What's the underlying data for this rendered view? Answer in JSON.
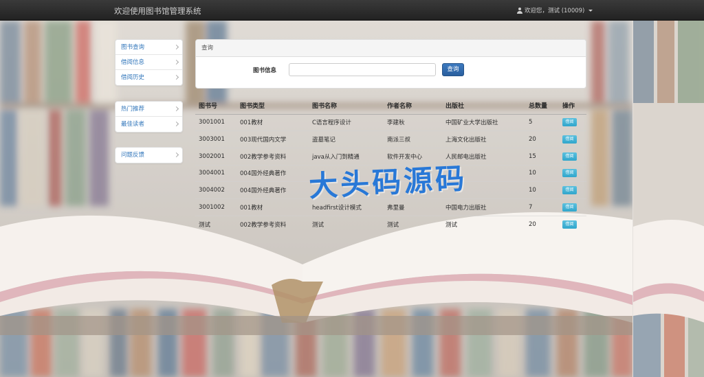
{
  "navbar": {
    "brand": "欢迎使用图书馆管理系统",
    "user_greeting": "欢迎您，测试 (10009)",
    "user_icon": "user-icon"
  },
  "sidebar": {
    "group1": [
      {
        "label": "图书查询"
      },
      {
        "label": "借阅信息"
      },
      {
        "label": "借阅历史"
      }
    ],
    "group2": [
      {
        "label": "热门推荐"
      },
      {
        "label": "最佳读者"
      }
    ],
    "group3": [
      {
        "label": "问题反馈"
      }
    ]
  },
  "query_panel": {
    "heading": "查询",
    "field_label": "图书信息",
    "input_value": "",
    "button_label": "查询"
  },
  "table": {
    "headers": [
      "图书号",
      "图书类型",
      "图书名称",
      "作者名称",
      "出版社",
      "总数量",
      "操作"
    ],
    "rows": [
      {
        "id": "3001001",
        "type": "001教材",
        "name": "C语言程序设计",
        "author": "李建秋",
        "publisher": "中国矿业大学出版社",
        "count": "5",
        "action": "借阅"
      },
      {
        "id": "3003001",
        "type": "003现代国内文学",
        "name": "盗墓笔记",
        "author": "南派三叔",
        "publisher": "上海文化出版社",
        "count": "20",
        "action": "借阅"
      },
      {
        "id": "3002001",
        "type": "002教学参考资料",
        "name": "java从入门到精通",
        "author": "软件开发中心",
        "publisher": "人民邮电出版社",
        "count": "15",
        "action": "借阅"
      },
      {
        "id": "3004001",
        "type": "004国外经典著作",
        "name": "",
        "author": "",
        "publisher": "",
        "count": "10",
        "action": "借阅"
      },
      {
        "id": "3004002",
        "type": "004国外经典著作",
        "name": "",
        "author": "",
        "publisher": "",
        "count": "10",
        "action": "借阅"
      },
      {
        "id": "3001002",
        "type": "001教材",
        "name": "headfirst设计模式",
        "author": "弗里曼",
        "publisher": "中国电力出版社",
        "count": "7",
        "action": "借阅"
      },
      {
        "id": "测试",
        "type": "002教学参考资料",
        "name": "测试",
        "author": "测试",
        "publisher": "测试",
        "count": "20",
        "action": "借阅"
      }
    ]
  },
  "watermark": "大头码源码",
  "colors": {
    "navbar": "#222222",
    "link": "#3377bb",
    "primary_button": "#2a5f9e",
    "info_button": "#31a6cc",
    "watermark": "#1f74d8"
  }
}
